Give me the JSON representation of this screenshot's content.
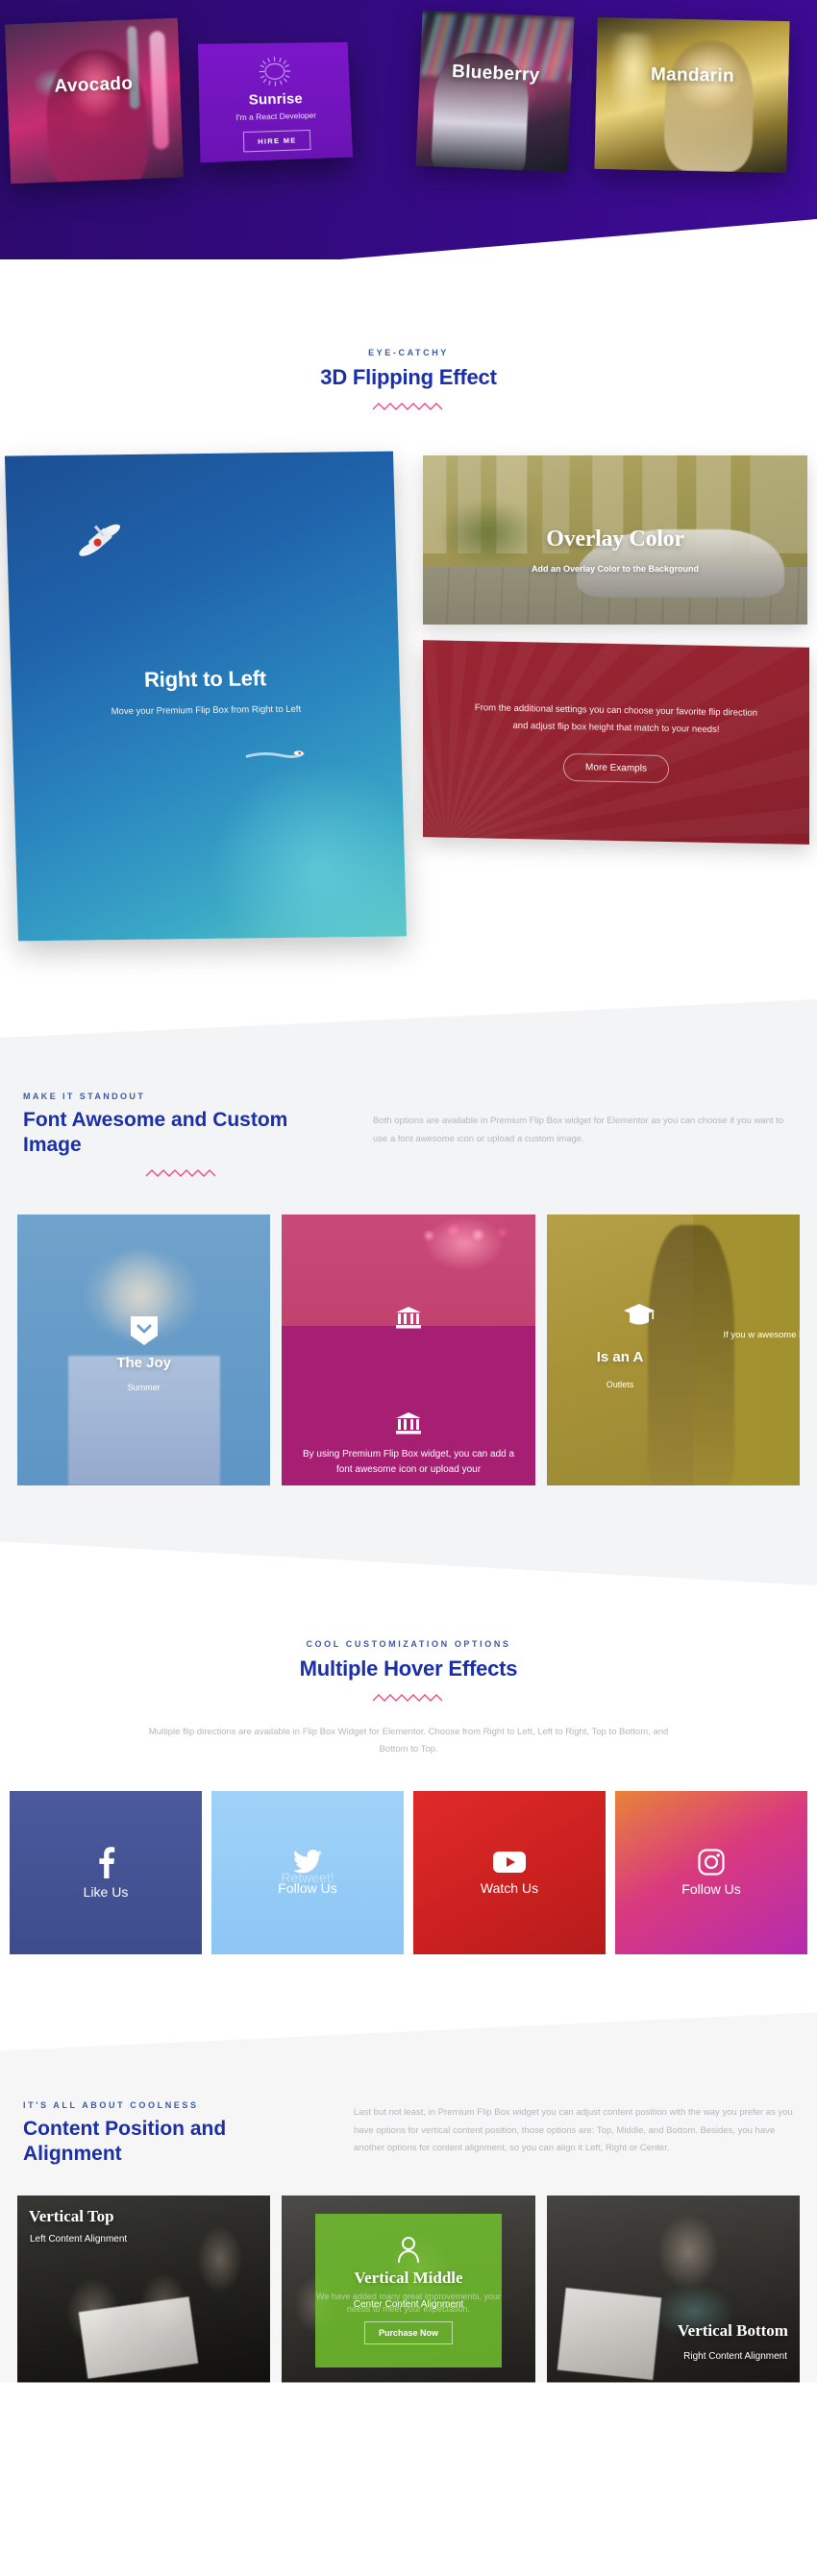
{
  "hero": {
    "cards": [
      {
        "label": "Avocado",
        "icon": "portrait-neon-pink"
      },
      {
        "label": "Blueberry",
        "icon": "portrait-neon-stripes"
      },
      {
        "label": "Mandarin",
        "icon": "portrait-neon-yellow"
      }
    ],
    "sunrise": {
      "icon": "sun-icon",
      "title": "Sunrise",
      "subtitle": "I'm a React Developer",
      "button": "HIRE ME"
    }
  },
  "flip_section": {
    "eyebrow": "EYE-CATCHY",
    "title": "3D Flipping Effect",
    "left_card": {
      "title": "Right to Left",
      "subtitle": "Move your Premium Flip Box from Right to Left"
    },
    "overlay_card": {
      "title": "Overlay Color",
      "subtitle": "Add an Overlay Color to the Background"
    },
    "red_card": {
      "text": "From the additional settings you can choose your favorite flip direction and adjust flip box height that match to your needs!",
      "button": "More Exampls"
    }
  },
  "standout_section": {
    "eyebrow": "MAKE IT STANDOUT",
    "title": "Font Awesome and Custom Image",
    "description": "Both options are available in Premium Flip Box widget for Elementor as you can choose if you want to use a font awesome icon or upload a custom image.",
    "cards": [
      {
        "icon": "chevron-down-icon",
        "title": "The Joy",
        "subtitle": "Summer"
      },
      {
        "icon": "bank-icon",
        "text": "By using Premium Flip Box widget, you can add a font awesome icon or upload your"
      },
      {
        "icon": "graduation-cap-icon",
        "title": "Is an A",
        "subtitle": "Outlets",
        "text": "If you w awesome have the a its size anc y"
      }
    ]
  },
  "hover_section": {
    "eyebrow": "COOL CUSTOMIZATION OPTIONS",
    "title": "Multiple Hover Effects",
    "description": "Multiple flip directions are available in Flip Box Widget for Elementor. Choose from Right to Left, Left to Right, Top to Bottom, and Bottom to Top.",
    "social": [
      {
        "icon": "facebook-icon",
        "label": "Like Us",
        "ghost": ""
      },
      {
        "icon": "twitter-icon",
        "label": "Follow Us",
        "ghost": "Retweet!"
      },
      {
        "icon": "youtube-icon",
        "label": "Watch Us",
        "ghost": ""
      },
      {
        "icon": "instagram-icon",
        "label": "Follow Us",
        "ghost": ""
      }
    ]
  },
  "content_section": {
    "eyebrow": "IT'S ALL ABOUT COOLNESS",
    "title": "Content Position and Alignment",
    "description": "Last but not least, in Premium Flip Box widget you can adjust content position with the way you prefer as you have options for vertical content position, those options are: Top, Middle, and Bottom. Besides, you have another options for content alignment, so you can align it Left, Right or Center.",
    "cards": [
      {
        "title": "Vertical Top",
        "subtitle": "Left Content Alignment"
      },
      {
        "title": "Vertical Middle",
        "subtitle": "Center Content Alignment",
        "button": "Purchase Now",
        "ghost": "We have added many great improvements, your needs to meet your expectation.",
        "icon": "person-icon"
      },
      {
        "title": "Vertical Bottom",
        "subtitle": "Right Content Alignment"
      }
    ]
  },
  "colors": {
    "brand_blue": "#1a2fa8",
    "eyebrow_blue": "#3d5aa9",
    "zigzag_pink": "#ef4a7d",
    "muted_text": "#b4b7bd",
    "hero_purple": "#330a80",
    "sunrise_purple": "#7b16c9",
    "red_card": "#93222f",
    "pink_card": "#a61f73",
    "gold_card": "#a2912f",
    "facebook": "#3d4c8c",
    "twitter": "#8cc6f5",
    "youtube": "#c9201f",
    "instagram": "#d93a7e",
    "green_overlay": "#74c72d"
  }
}
